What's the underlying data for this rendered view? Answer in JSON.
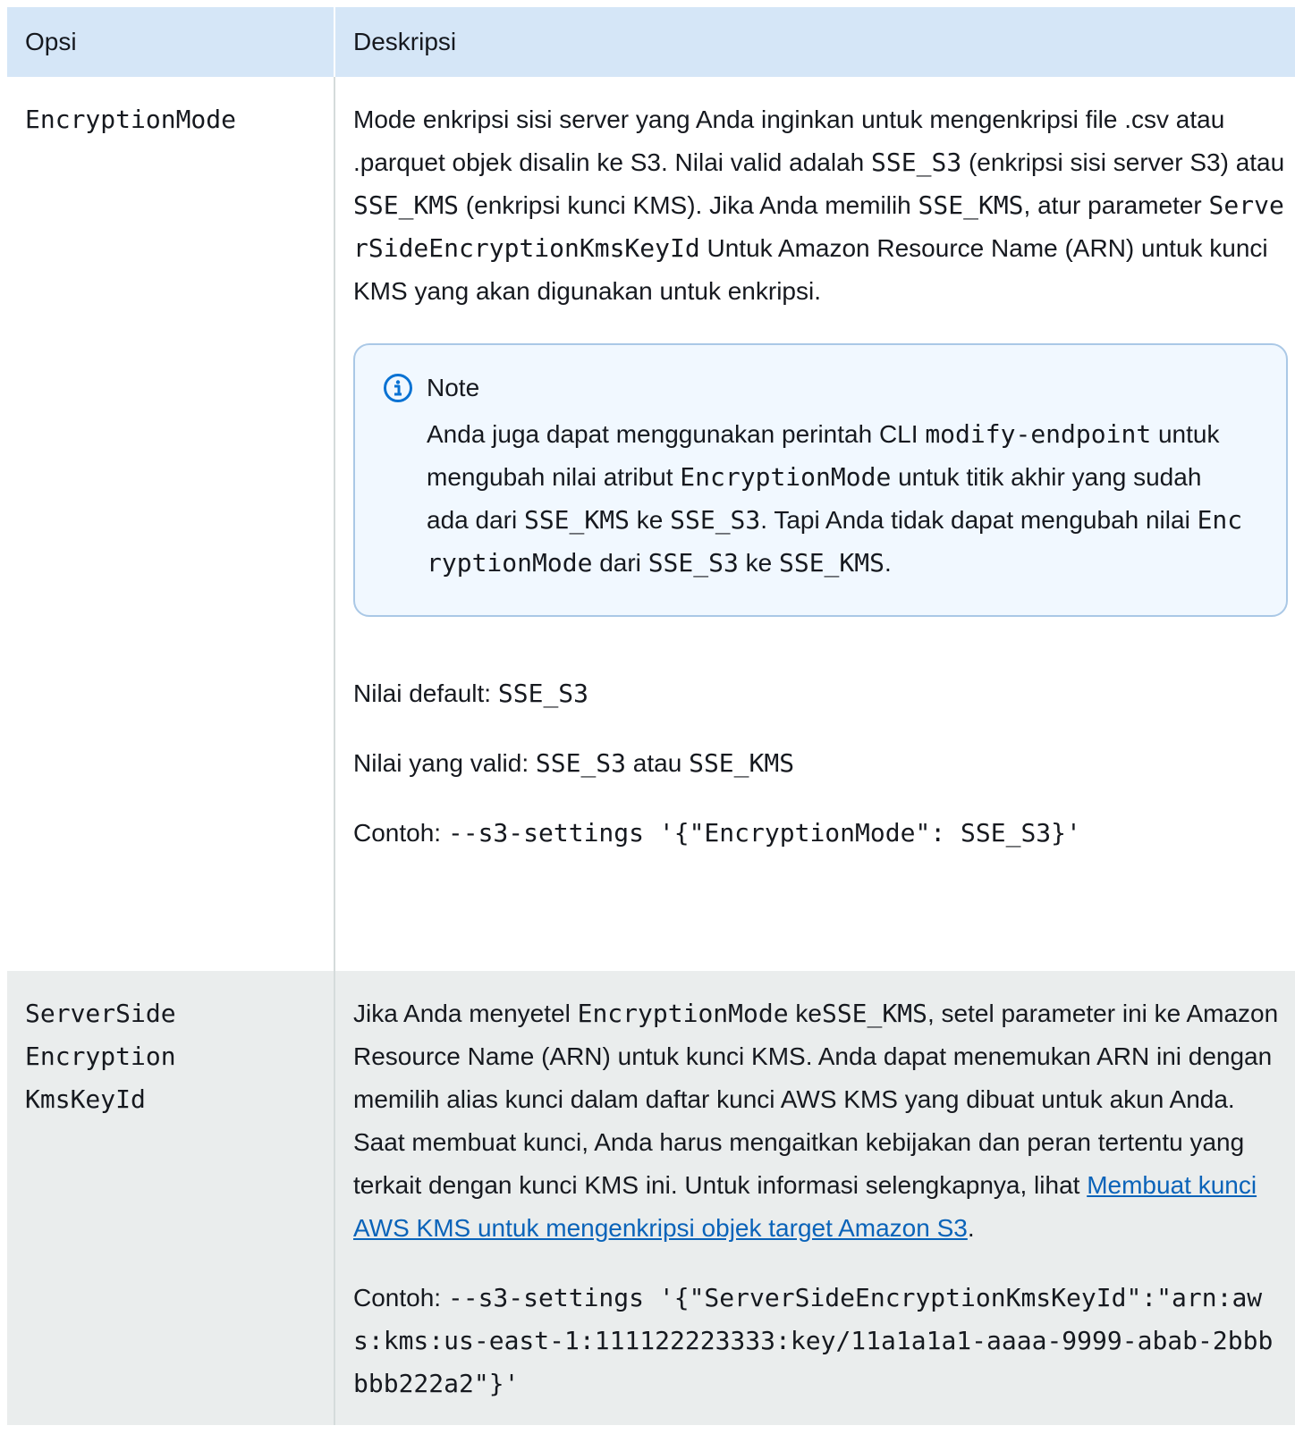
{
  "table": {
    "headers": {
      "option": "Opsi",
      "description": "Deskripsi"
    },
    "rows": [
      {
        "option": "EncryptionMode",
        "desc": {
          "t1": "Mode enkripsi sisi server yang Anda inginkan untuk mengenkripsi file .csv atau .parquet objek disalin ke S3. Nilai valid adalah ",
          "c1": "SSE_S3",
          "t2": " (enkripsi sisi server S3) atau ",
          "c2": "SSE_KMS",
          "t3": " (enkripsi kunci KMS). Jika Anda memilih ",
          "c3": "SSE_KMS",
          "t4": ", atur parameter ",
          "c4": "ServerSideEncryptionKmsKeyId",
          "t5": "   Untuk Amazon Resource Name (ARN) untuk kunci KMS yang akan digunakan untuk enkripsi."
        },
        "note": {
          "icon": "info-icon",
          "title": "Note",
          "t1": "Anda juga dapat menggunakan perintah CLI ",
          "c1": "modify-endpoint",
          "t2": "  untuk mengubah nilai atribut ",
          "c2": "EncryptionMode",
          "t3": " untuk titik akhir yang sudah ada dari ",
          "c3": "SSE_KMS",
          "t4": " ke ",
          "c4": "SSE_S3",
          "t5": ". Tapi Anda tidak dapat mengubah nilai ",
          "c5": "EncryptionMode",
          "t6": "  dari ",
          "c6": "SSE_S3",
          "t7": " ke ",
          "c7": "SSE_KMS",
          "t8": "."
        },
        "default_label": "Nilai default: ",
        "default_value": "SSE_S3",
        "valid_label": "Nilai yang valid: ",
        "valid_v1": "SSE_S3",
        "valid_mid": " atau ",
        "valid_v2": "SSE_KMS",
        "example_label": "Contoh: ",
        "example_code": "--s3-settings '{\"EncryptionMode\": SSE_S3}'"
      },
      {
        "option": "ServerSideEncryptionKmsKeyId",
        "desc": {
          "t1": "Jika Anda menyetel ",
          "c1": "EncryptionMode",
          "t2": "  ke",
          "c2": "SSE_KMS",
          "t3": ", setel parameter ini ke Amazon Resource Name (ARN) untuk kunci KMS. Anda dapat menemukan ARN ini dengan memilih alias kunci dalam daftar kunci AWS KMS yang dibuat untuk akun Anda. Saat membuat kunci, Anda harus mengaitkan kebijakan dan peran tertentu yang terkait dengan kunci KMS ini. Untuk informasi selengkapnya, lihat ",
          "link": "Membuat kunci AWS KMS untuk mengenkripsi objek target Amazon S3",
          "t4": "."
        },
        "example_label": "Contoh: ",
        "example_code": "--s3-settings '{\"ServerSideEncryptionKmsKeyId\":\"arn:aws:kms:us-east-1:111122223333:key/11a1a1a1-aaaa-9999-abab-2bbbbbb222a2\"}'"
      }
    ]
  },
  "colors": {
    "header_bg": "#d5e6f7",
    "row_alt_bg": "#eaeded",
    "note_bg": "#f1f8ff",
    "note_border": "#aac8e6",
    "link": "#0a63b9",
    "info_icon": "#0972d3"
  }
}
